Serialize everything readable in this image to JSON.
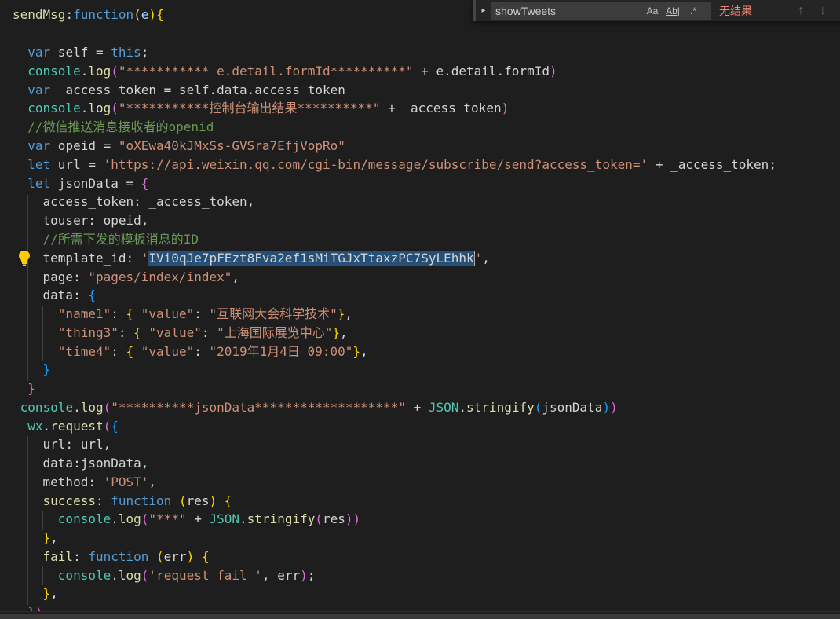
{
  "find": {
    "query": "showTweets",
    "match_case_label": "Aa",
    "whole_word_label": "Ab|",
    "regex_label": ".*",
    "result": "无结果",
    "prev_label": "↑",
    "next_label": "↓",
    "toggle_label": "▸"
  },
  "code": {
    "lines": [
      [
        [
          "fn",
          "sendMsg"
        ],
        [
          "plain",
          ":"
        ],
        [
          "kw",
          "function"
        ],
        [
          "brace3",
          "("
        ],
        [
          "prop",
          "e"
        ],
        [
          "brace3",
          ")"
        ],
        [
          "brace3",
          "{"
        ]
      ],
      [],
      [
        [
          "plain",
          "  "
        ],
        [
          "kw",
          "var"
        ],
        [
          "plain",
          " self = "
        ],
        [
          "kw",
          "this"
        ],
        [
          "plain",
          ";"
        ]
      ],
      [
        [
          "plain",
          "  "
        ],
        [
          "obj",
          "console"
        ],
        [
          "plain",
          "."
        ],
        [
          "fn",
          "log"
        ],
        [
          "brace",
          "("
        ],
        [
          "str",
          "\"*********** e.detail.formId**********\""
        ],
        [
          "plain",
          " + e.detail.formId"
        ],
        [
          "brace",
          ")"
        ]
      ],
      [
        [
          "plain",
          "  "
        ],
        [
          "kw",
          "var"
        ],
        [
          "plain",
          " _access_token = self.data.access_token"
        ]
      ],
      [
        [
          "plain",
          "  "
        ],
        [
          "obj",
          "console"
        ],
        [
          "plain",
          "."
        ],
        [
          "fn",
          "log"
        ],
        [
          "brace",
          "("
        ],
        [
          "str",
          "\"***********控制台输出结果**********\""
        ],
        [
          "plain",
          " + _access_token"
        ],
        [
          "brace",
          ")"
        ]
      ],
      [
        [
          "plain",
          "  "
        ],
        [
          "comment",
          "//微信推送消息接收者的openid"
        ]
      ],
      [
        [
          "plain",
          "  "
        ],
        [
          "kw",
          "var"
        ],
        [
          "plain",
          " opeid = "
        ],
        [
          "str",
          "\"oXEwa40kJMxSs-GVSra7EfjVopRo\""
        ]
      ],
      [
        [
          "plain",
          "  "
        ],
        [
          "kw",
          "let"
        ],
        [
          "plain",
          " url = "
        ],
        [
          "str",
          "'"
        ],
        [
          "url",
          "https://api.weixin.qq.com/cgi-bin/message/subscribe/send?access_token="
        ],
        [
          "str",
          "'"
        ],
        [
          "plain",
          " + _access_token;"
        ]
      ],
      [
        [
          "plain",
          "  "
        ],
        [
          "kw",
          "let"
        ],
        [
          "plain",
          " jsonData = "
        ],
        [
          "brace",
          "{"
        ]
      ],
      [
        [
          "plain",
          "    access_token: _access_token,"
        ]
      ],
      [
        [
          "plain",
          "    touser: opeid,"
        ]
      ],
      [
        [
          "plain",
          "    "
        ],
        [
          "comment",
          "//所需下发的模板消息的ID"
        ]
      ],
      [
        [
          "plain",
          "    template_id: "
        ],
        [
          "str",
          "'"
        ],
        [
          "sel",
          "IVi0qJe7pFEzt8Fva2ef1sMiTGJxTtaxzPC7SyLEhhk"
        ],
        [
          "cursor",
          ""
        ],
        [
          "str",
          "'"
        ],
        [
          "plain",
          ","
        ]
      ],
      [
        [
          "plain",
          "    page: "
        ],
        [
          "str",
          "\"pages/index/index\""
        ],
        [
          "plain",
          ","
        ]
      ],
      [
        [
          "plain",
          "    data: "
        ],
        [
          "brace2",
          "{"
        ]
      ],
      [
        [
          "plain",
          "      "
        ],
        [
          "str",
          "\"name1\""
        ],
        [
          "plain",
          ": "
        ],
        [
          "brace3",
          "{"
        ],
        [
          "plain",
          " "
        ],
        [
          "str",
          "\"value\""
        ],
        [
          "plain",
          ": "
        ],
        [
          "str",
          "\"互联网大会科学技术\""
        ],
        [
          "brace3",
          "}"
        ],
        [
          "plain",
          ","
        ]
      ],
      [
        [
          "plain",
          "      "
        ],
        [
          "str",
          "\"thing3\""
        ],
        [
          "plain",
          ": "
        ],
        [
          "brace3",
          "{"
        ],
        [
          "plain",
          " "
        ],
        [
          "str",
          "\"value\""
        ],
        [
          "plain",
          ": "
        ],
        [
          "str",
          "\"上海国际展览中心\""
        ],
        [
          "brace3",
          "}"
        ],
        [
          "plain",
          ","
        ]
      ],
      [
        [
          "plain",
          "      "
        ],
        [
          "str",
          "\"time4\""
        ],
        [
          "plain",
          ": "
        ],
        [
          "brace3",
          "{"
        ],
        [
          "plain",
          " "
        ],
        [
          "str",
          "\"value\""
        ],
        [
          "plain",
          ": "
        ],
        [
          "str",
          "\"2019年1月4日 09:00\""
        ],
        [
          "brace3",
          "}"
        ],
        [
          "plain",
          ","
        ]
      ],
      [
        [
          "plain",
          "    "
        ],
        [
          "brace2",
          "}"
        ]
      ],
      [
        [
          "plain",
          "  "
        ],
        [
          "brace",
          "}"
        ]
      ],
      [
        [
          "plain",
          " "
        ],
        [
          "obj",
          "console"
        ],
        [
          "plain",
          "."
        ],
        [
          "fn",
          "log"
        ],
        [
          "brace",
          "("
        ],
        [
          "str",
          "\"**********jsonData*******************\""
        ],
        [
          "plain",
          " + "
        ],
        [
          "obj",
          "JSON"
        ],
        [
          "plain",
          "."
        ],
        [
          "fn",
          "stringify"
        ],
        [
          "brace2",
          "("
        ],
        [
          "plain",
          "jsonData"
        ],
        [
          "brace2",
          ")"
        ],
        [
          "brace",
          ")"
        ]
      ],
      [
        [
          "plain",
          "  "
        ],
        [
          "obj",
          "wx"
        ],
        [
          "plain",
          "."
        ],
        [
          "fn",
          "request"
        ],
        [
          "brace",
          "("
        ],
        [
          "brace2",
          "{"
        ]
      ],
      [
        [
          "plain",
          "    url: url,"
        ]
      ],
      [
        [
          "plain",
          "    data:jsonData,"
        ]
      ],
      [
        [
          "plain",
          "    method: "
        ],
        [
          "str",
          "'POST'"
        ],
        [
          "plain",
          ","
        ]
      ],
      [
        [
          "plain",
          "    "
        ],
        [
          "fn",
          "success"
        ],
        [
          "plain",
          ": "
        ],
        [
          "kw",
          "function"
        ],
        [
          "plain",
          " "
        ],
        [
          "brace3",
          "("
        ],
        [
          "plain",
          "res"
        ],
        [
          "brace3",
          ")"
        ],
        [
          "plain",
          " "
        ],
        [
          "brace3",
          "{"
        ]
      ],
      [
        [
          "plain",
          "      "
        ],
        [
          "obj",
          "console"
        ],
        [
          "plain",
          "."
        ],
        [
          "fn",
          "log"
        ],
        [
          "brace",
          "("
        ],
        [
          "str",
          "\"***\""
        ],
        [
          "plain",
          " + "
        ],
        [
          "obj",
          "JSON"
        ],
        [
          "plain",
          "."
        ],
        [
          "fn",
          "stringify"
        ],
        [
          "brace",
          "("
        ],
        [
          "plain",
          "res"
        ],
        [
          "brace",
          "))"
        ]
      ],
      [
        [
          "plain",
          "    "
        ],
        [
          "brace3",
          "}"
        ],
        [
          "plain",
          ","
        ]
      ],
      [
        [
          "plain",
          "    "
        ],
        [
          "fn",
          "fail"
        ],
        [
          "plain",
          ": "
        ],
        [
          "kw",
          "function"
        ],
        [
          "plain",
          " "
        ],
        [
          "brace3",
          "("
        ],
        [
          "plain",
          "err"
        ],
        [
          "brace3",
          ")"
        ],
        [
          "plain",
          " "
        ],
        [
          "brace3",
          "{"
        ]
      ],
      [
        [
          "plain",
          "      "
        ],
        [
          "obj",
          "console"
        ],
        [
          "plain",
          "."
        ],
        [
          "fn",
          "log"
        ],
        [
          "brace",
          "("
        ],
        [
          "str",
          "'request fail '"
        ],
        [
          "plain",
          ", err"
        ],
        [
          "brace",
          ")"
        ],
        [
          "plain",
          ";"
        ]
      ],
      [
        [
          "plain",
          "    "
        ],
        [
          "brace3",
          "}"
        ],
        [
          "plain",
          ","
        ]
      ],
      [
        [
          "plain",
          "  "
        ],
        [
          "brace2",
          "}"
        ],
        [
          "brace",
          ")"
        ]
      ]
    ]
  }
}
